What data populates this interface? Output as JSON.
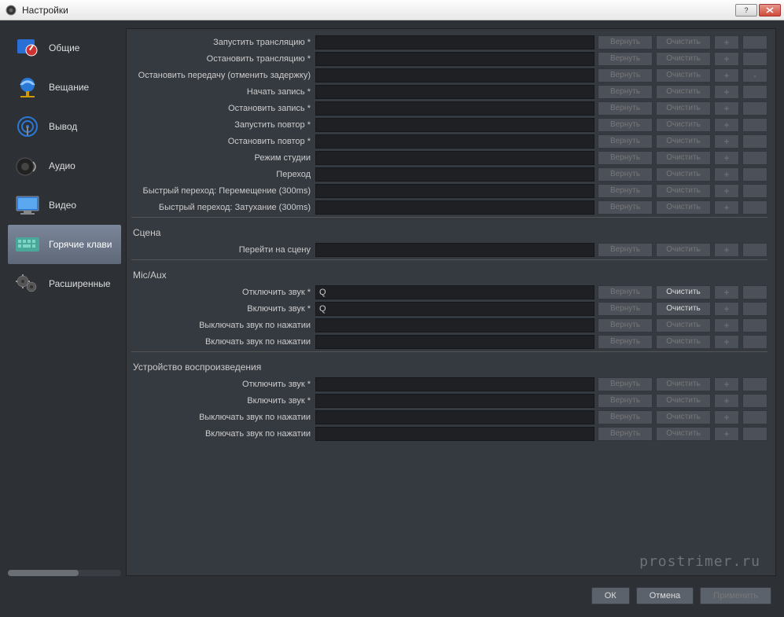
{
  "window": {
    "title": "Настройки"
  },
  "sidebar": {
    "items": [
      {
        "label": "Общие",
        "icon": "general"
      },
      {
        "label": "Вещание",
        "icon": "stream"
      },
      {
        "label": "Вывод",
        "icon": "output"
      },
      {
        "label": "Аудио",
        "icon": "audio"
      },
      {
        "label": "Видео",
        "icon": "video"
      },
      {
        "label": "Горячие клави",
        "icon": "hotkeys",
        "selected": true
      },
      {
        "label": "Расширенные",
        "icon": "advanced"
      }
    ]
  },
  "buttons": {
    "revert": "Вернуть",
    "clear": "Очистить",
    "add": "+",
    "remove": "-"
  },
  "groups": [
    {
      "title": "",
      "rows": [
        {
          "label": "Запустить трансляцию *",
          "value": "",
          "remove": false
        },
        {
          "label": "Остановить трансляцию *",
          "value": "",
          "remove": false
        },
        {
          "label": "Остановить передачу (отменить задержку)",
          "value": "",
          "remove": true
        },
        {
          "label": "Начать запись *",
          "value": "",
          "remove": false
        },
        {
          "label": "Остановить запись *",
          "value": "",
          "remove": false
        },
        {
          "label": "Запустить повтор *",
          "value": "",
          "remove": false
        },
        {
          "label": "Остановить повтор *",
          "value": "",
          "remove": false
        },
        {
          "label": "Режим студии",
          "value": "",
          "remove": false
        },
        {
          "label": "Переход",
          "value": "",
          "remove": false
        },
        {
          "label": "Быстрый переход: Перемещение (300ms)",
          "value": "",
          "remove": false
        },
        {
          "label": "Быстрый переход: Затухание (300ms)",
          "value": "",
          "remove": false
        }
      ]
    },
    {
      "title": "Сцена",
      "rows": [
        {
          "label": "Перейти на сцену",
          "value": "",
          "remove": false
        }
      ]
    },
    {
      "title": "Mic/Aux",
      "rows": [
        {
          "label": "Отключить звук *",
          "value": "Q",
          "clearActive": true,
          "remove": false
        },
        {
          "label": "Включить звук *",
          "value": "Q",
          "clearActive": true,
          "remove": false
        },
        {
          "label": "Выключать звук по нажатии",
          "value": "",
          "remove": false
        },
        {
          "label": "Включать звук по нажатии",
          "value": "",
          "remove": false
        }
      ]
    },
    {
      "title": "Устройство воспроизведения",
      "rows": [
        {
          "label": "Отключить звук *",
          "value": "",
          "remove": false
        },
        {
          "label": "Включить звук *",
          "value": "",
          "remove": false
        },
        {
          "label": "Выключать звук по нажатии",
          "value": "",
          "remove": false
        },
        {
          "label": "Включать звук по нажатии",
          "value": "",
          "remove": false
        }
      ]
    }
  ],
  "footer": {
    "ok": "ОК",
    "cancel": "Отмена",
    "apply": "Применить"
  },
  "watermark": "prostrimer.ru"
}
